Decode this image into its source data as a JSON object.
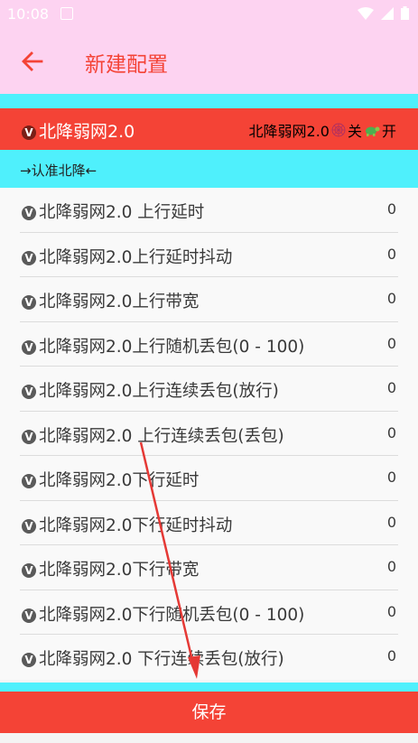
{
  "status": {
    "time": "10:08"
  },
  "appbar": {
    "title": "新建配置"
  },
  "header": {
    "left_label": "北降弱网2.0",
    "right_label": "北降弱网2.0",
    "off_label": "关",
    "on_label": "开"
  },
  "notice": {
    "text": "→认准北降←"
  },
  "items": [
    {
      "label": "北降弱网2.0 上行延时",
      "value": "0"
    },
    {
      "label": "北降弱网2.0上行延时抖动",
      "value": "0"
    },
    {
      "label": "北降弱网2.0上行带宽",
      "value": "0"
    },
    {
      "label": "北降弱网2.0上行随机丢包(0 - 100)",
      "value": "0"
    },
    {
      "label": "北降弱网2.0上行连续丢包(放行)",
      "value": "0"
    },
    {
      "label": "北降弱网2.0 上行连续丢包(丢包)",
      "value": "0"
    },
    {
      "label": "北降弱网2.0下行延时",
      "value": "0"
    },
    {
      "label": "北降弱网2.0下行延时抖动",
      "value": "0"
    },
    {
      "label": "北降弱网2.0下行带宽",
      "value": "0"
    },
    {
      "label": "北降弱网2.0下行随机丢包(0 - 100)",
      "value": "0"
    },
    {
      "label": "北降弱网2.0 下行连续丢包(放行)",
      "value": "0"
    }
  ],
  "save_button": {
    "label": "保存"
  },
  "badge_letter": "V",
  "colors": {
    "accent": "#f44336",
    "cyan": "#4ff0fc",
    "pink": "#fdd3f1"
  }
}
